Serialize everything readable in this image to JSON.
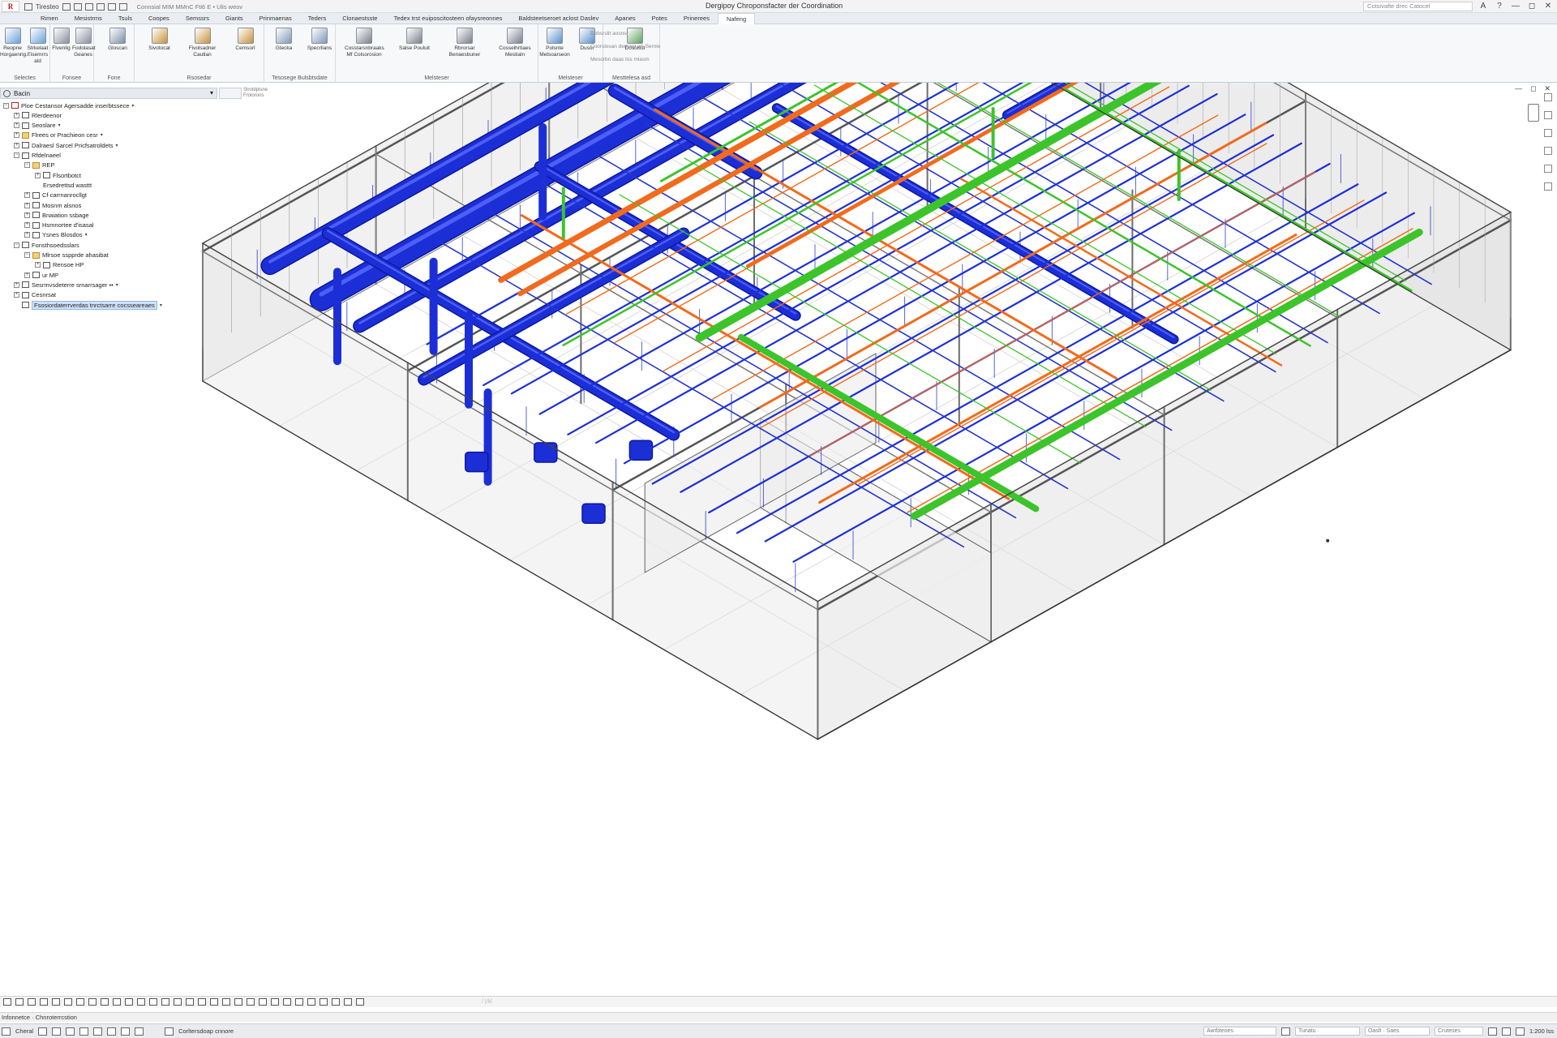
{
  "titlebar": {
    "app_logo": "R",
    "qat_label": "Tiresteo",
    "qat_file": "Connsial MIM MMnC Fti6 E • Ulis weov",
    "title": "Dergipoy Chroponsfacter der Coordination",
    "search_placeholder": "Cotsivafte drec Catocel",
    "controls": [
      "—",
      "◻",
      "✕"
    ]
  },
  "menubar": {
    "items": [
      "Rimen",
      "Mesistrms",
      "Tsuls",
      "Coopes",
      "Semssrs",
      "Giants",
      "Prinmaenas",
      "Teders",
      "Clonaestsste",
      "Tedex trst euiposcitosteen ofaysreonnes",
      "Baldsteetseroet aclost Daslev",
      "Apanes",
      "Potes",
      "Prinerees",
      "Nafeng"
    ],
    "active_index": 14
  },
  "ribbon": {
    "groups": [
      {
        "label": "Selectes",
        "buttons": [
          "Reopne Horgaenrig...",
          "Strkelaat Fisemrrs ald"
        ]
      },
      {
        "label": "Fonsee",
        "buttons": [
          "Flvenlig",
          "Fodolasat Geanes"
        ]
      },
      {
        "label": "Fone",
        "buttons": [
          "Gloscan"
        ]
      },
      {
        "label": "Rsosedar",
        "buttons": [
          "Sivotocat",
          "Fivolsadner Cautlan",
          "Cemsorl"
        ]
      },
      {
        "label": "Tesosege Bulsbtsdate",
        "buttons": [
          "Gtecka",
          "Specrlians"
        ]
      },
      {
        "label": "Melsteser",
        "buttons": [
          "Cosstarsnbraaks Mf Colsorosion",
          "Salse Pouluit",
          "Rbrorsar Benaesbuner",
          "Cosselhrtiaes Mestialn"
        ]
      },
      {
        "label": "Melsteser",
        "buttons": [
          "Polsnte Metsoarseon",
          "Dusor"
        ]
      },
      {
        "label": "Mesttelesa asd",
        "buttons": [
          "Dosolsst"
        ]
      }
    ],
    "options": [
      "Debsrslit aosnsr",
      "Coorslosan demaor an Sernie",
      "Mesorbn daas tos mlasm"
    ]
  },
  "browser": {
    "title": "Bacin",
    "side_note": [
      "Slrotdpisne",
      "Frolorons"
    ],
    "tree": [
      {
        "label": "Ploe Cestansor Agersadde inserbtssece",
        "depth": 0,
        "expand": "−",
        "icon": "red",
        "dropdown": true
      },
      {
        "label": "Rlerdeenor",
        "depth": 1,
        "expand": "+",
        "icon": "box"
      },
      {
        "label": "Seoslare",
        "depth": 1,
        "expand": "+",
        "icon": "box",
        "dropdown": true
      },
      {
        "label": "Flrees or Prachieon cesr",
        "depth": 1,
        "expand": "+",
        "icon": "fold",
        "dropdown": true
      },
      {
        "label": "Dalraesl Sarcel Pricfsatroldets",
        "depth": 1,
        "expand": "+",
        "icon": "box",
        "dropdown": true
      },
      {
        "label": "Rfdelnaeel",
        "depth": 1,
        "expand": "−",
        "icon": "box"
      },
      {
        "label": "REP",
        "depth": 2,
        "expand": "−",
        "icon": "fold"
      },
      {
        "label": "Flsortbotct",
        "depth": 3,
        "expand": "+",
        "icon": "box"
      },
      {
        "label": "Ersedrettsd wasttt",
        "depth": 3,
        "expand": "",
        "icon": ""
      },
      {
        "label": "Cf carrnanrocllgt",
        "depth": 2,
        "expand": "+",
        "icon": "box"
      },
      {
        "label": "Mosnm alsnos",
        "depth": 2,
        "expand": "+",
        "icon": "box"
      },
      {
        "label": "Bnaiation ssbage",
        "depth": 2,
        "expand": "+",
        "icon": "box"
      },
      {
        "label": "Hsmnortee d'isasal",
        "depth": 2,
        "expand": "+",
        "icon": "box"
      },
      {
        "label": "Ysnes Blosdos",
        "depth": 2,
        "expand": "+",
        "icon": "box",
        "dropdown": true
      },
      {
        "label": "Fonsthsoedsslars",
        "depth": 1,
        "expand": "−",
        "icon": "box"
      },
      {
        "label": "Mlrsoe sspprde ahasibat",
        "depth": 2,
        "expand": "−",
        "icon": "fold"
      },
      {
        "label": "Rensoe HP",
        "depth": 3,
        "expand": "+",
        "icon": "box"
      },
      {
        "label": "ur MP",
        "depth": 2,
        "expand": "+",
        "icon": "box"
      },
      {
        "label": "Sesrmvsdeterre srnarrsager ••",
        "depth": 1,
        "expand": "+",
        "icon": "box",
        "dropdown": true
      },
      {
        "label": "Cesnrsat",
        "depth": 1,
        "expand": "+",
        "icon": "box"
      },
      {
        "label": "Fsosiordaterrverdas tnrctsarre cocsseareaes",
        "depth": 1,
        "expand": "",
        "icon": "box",
        "selected": true,
        "dropdown": true
      }
    ]
  },
  "viewbar": {
    "scale": "",
    "ghost": "/ |/kl"
  },
  "status": {
    "line": "Infonnetce · Chnroterrcstion",
    "app_label": "Cheral",
    "cmd_label": "Corltersdoap cnnore",
    "field1": "Awrbteoes",
    "field2": "Tunatu ·",
    "field3": "Oaslt · Saes",
    "field4": "Cruteses",
    "zoom": "1:200 lss"
  },
  "colors": {
    "duct": "#1c2fd6",
    "duct_dark": "#0b18a0",
    "hot_pipe": "#f26a1b",
    "green_pipe": "#3cc42a",
    "structure": "#6d6d6d",
    "wall_fill": "#e8e8e8"
  }
}
